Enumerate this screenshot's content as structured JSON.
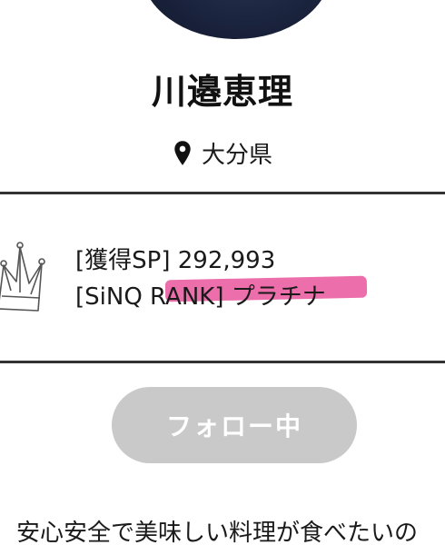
{
  "profile": {
    "name": "川邉恵理",
    "location": "大分県",
    "bio_text": "安心安全で美味しい料理が食べたいの"
  },
  "stats": {
    "sp_label": "[獲得SP]",
    "sp_value": "292,993",
    "rank_label": "[SiNQ RANK]",
    "rank_value": "プラチナ"
  },
  "actions": {
    "follow_label": "フォロー中"
  },
  "icons": {
    "location": "map-pin-icon",
    "rank": "crown-icon"
  },
  "colors": {
    "highlight": "#e9559b",
    "follow_button_bg": "#c9c9c9",
    "divider": "#333333"
  }
}
